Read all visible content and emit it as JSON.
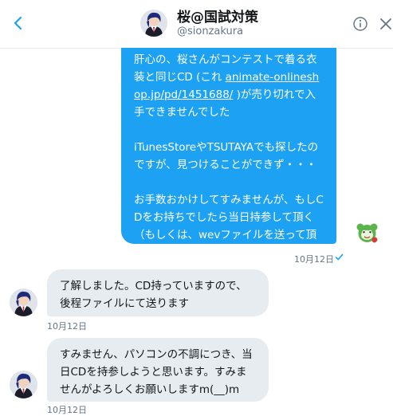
{
  "header": {
    "display_name": "桜@国試対策",
    "handle": "@sionzakura"
  },
  "messages": [
    {
      "direction": "outgoing",
      "paragraphs": [
        {
          "before_link": "肝心の、桜さんがコンテストで着る衣装と同じCD (これ ",
          "link": "animate-onlineshop.jp/pd/1451688/",
          "after_link": " )が売り切れで入手できませんでした"
        },
        {
          "text": "iTunesStoreやTSUTAYAでも探したのですが、見つけることができず・・・"
        },
        {
          "text": "お手数おかけしてすみませんが、もしCDをお持ちでしたら当日持参して頂く（もしくは、wevファイルを送って頂く）ことは可能でしょうか？"
        }
      ],
      "timestamp": "10月12日"
    },
    {
      "direction": "incoming",
      "text": "了解しました。CD持っていますので、後程ファイルにて送ります",
      "timestamp": "10月12日"
    },
    {
      "direction": "incoming",
      "text": "すみません、パソコンの不調につき、当日CDを持参しようと思います。すみませんがよろしくお願いしますm(__)m",
      "timestamp": "10月12日"
    }
  ],
  "icons": {
    "back": "chevron-left-icon",
    "info": "info-icon",
    "close": "close-icon",
    "read": "check-icon"
  },
  "colors": {
    "accent": "#1da1f2",
    "incoming_bubble": "#e6ecf0",
    "text_primary": "#14171a",
    "text_secondary": "#657786"
  }
}
